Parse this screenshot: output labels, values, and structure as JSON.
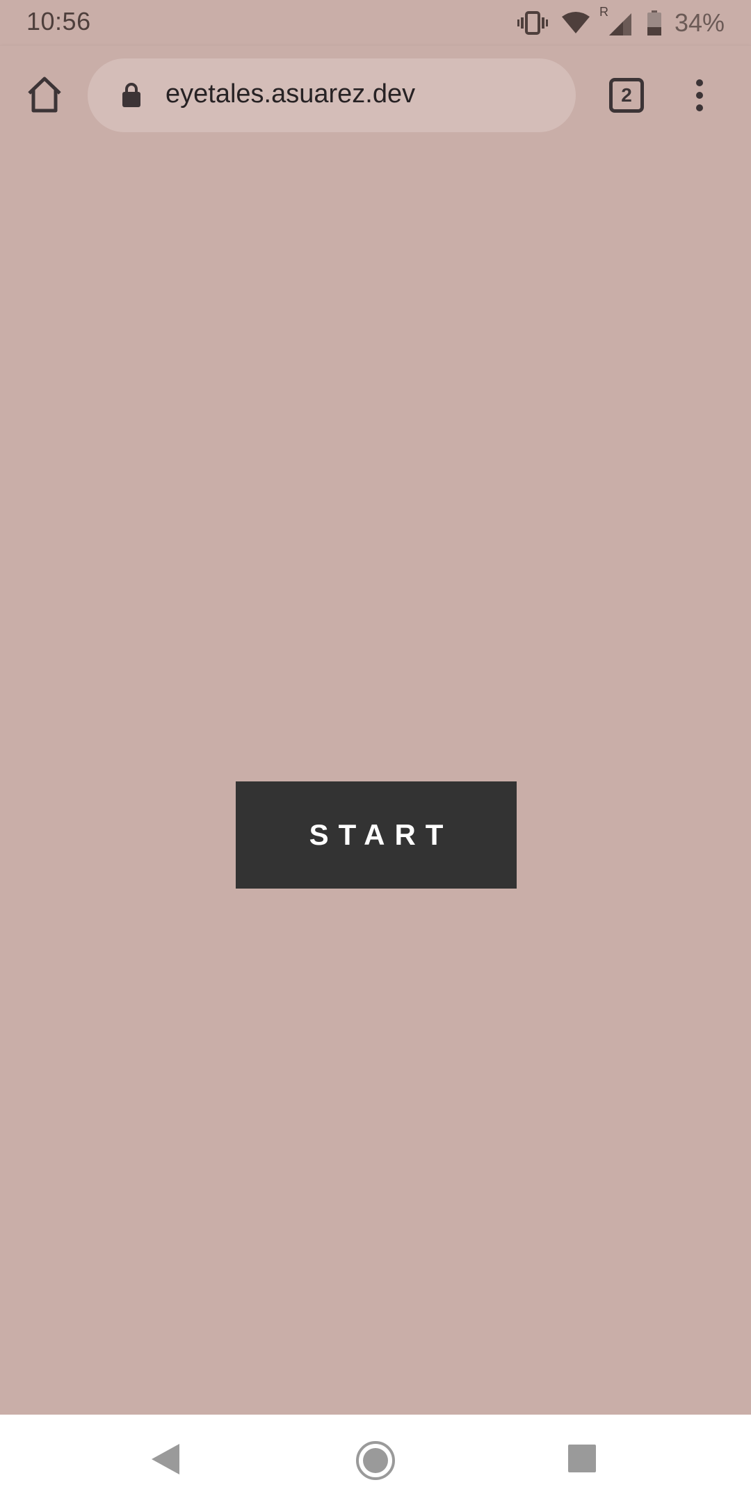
{
  "status_bar": {
    "time": "10:56",
    "battery_percent": "34%",
    "icons": [
      "vibrate-icon",
      "wifi-icon",
      "signal-icon",
      "battery-icon"
    ],
    "roaming_label": "R"
  },
  "browser": {
    "url": "eyetales.asuarez.dev",
    "tab_count": "2",
    "icons": [
      "home-icon",
      "lock-icon",
      "tab-switcher-icon",
      "more-menu-icon"
    ]
  },
  "page": {
    "start_label": "START",
    "background_color": "#c9aea8",
    "button_color": "#333333"
  },
  "nav_bar": {
    "icons": [
      "back-icon",
      "home-nav-icon",
      "recents-icon"
    ]
  }
}
